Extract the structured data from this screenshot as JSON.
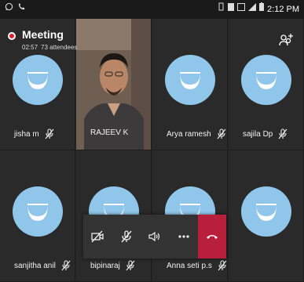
{
  "status_bar": {
    "time": "2:12 PM"
  },
  "meeting": {
    "title": "Meeting",
    "duration": "02:57",
    "attendees": "73 attendees"
  },
  "participants": [
    {
      "name": "jisha m",
      "muted": true,
      "video": false
    },
    {
      "name": "RAJEEV K",
      "muted": false,
      "video": true
    },
    {
      "name": "Arya ramesh",
      "muted": true,
      "video": false
    },
    {
      "name": "sajila Dp",
      "muted": true,
      "video": false
    },
    {
      "name": "sanjitha anil",
      "muted": true,
      "video": false
    },
    {
      "name": "bipinaraj",
      "muted": true,
      "video": false
    },
    {
      "name": "Anna seti p.s",
      "muted": true,
      "video": false
    },
    {
      "name": "",
      "muted": false,
      "video": false
    }
  ],
  "controls": {
    "video_toggle_icon": "video-off-icon",
    "mic_toggle_icon": "mic-off-icon",
    "speaker_icon": "speaker-icon",
    "more_icon": "more-icon",
    "hangup_icon": "hang-up-icon",
    "hangup_color": "#b81f3a"
  },
  "colors": {
    "avatar": "#8fc6ea",
    "record_dot": "#d6212a",
    "tile_bg": "#2a2a2a"
  }
}
